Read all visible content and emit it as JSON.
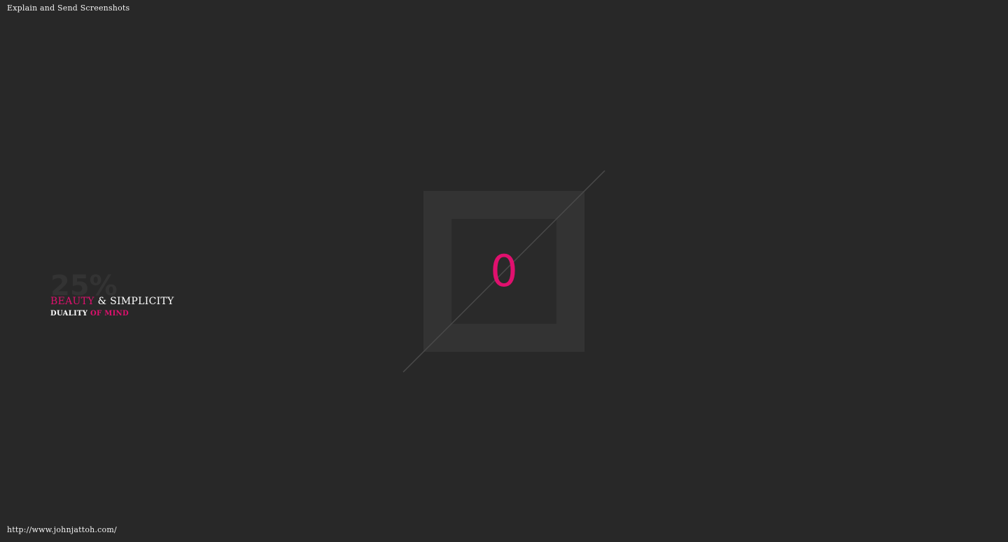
{
  "header": {
    "title": "Explain and Send Screenshots"
  },
  "footer": {
    "url": "http://www.johnjattoh.com/"
  },
  "loader": {
    "progress_label": "25%",
    "progress_value": 25,
    "counter": "0",
    "accent_color": "#e0106e"
  },
  "tagline": {
    "line1_part1": "BEAUTY",
    "line1_part2": " & SIMPLICITY",
    "line2_part1": "DUALITY",
    "line2_part2": " OF MIND"
  }
}
